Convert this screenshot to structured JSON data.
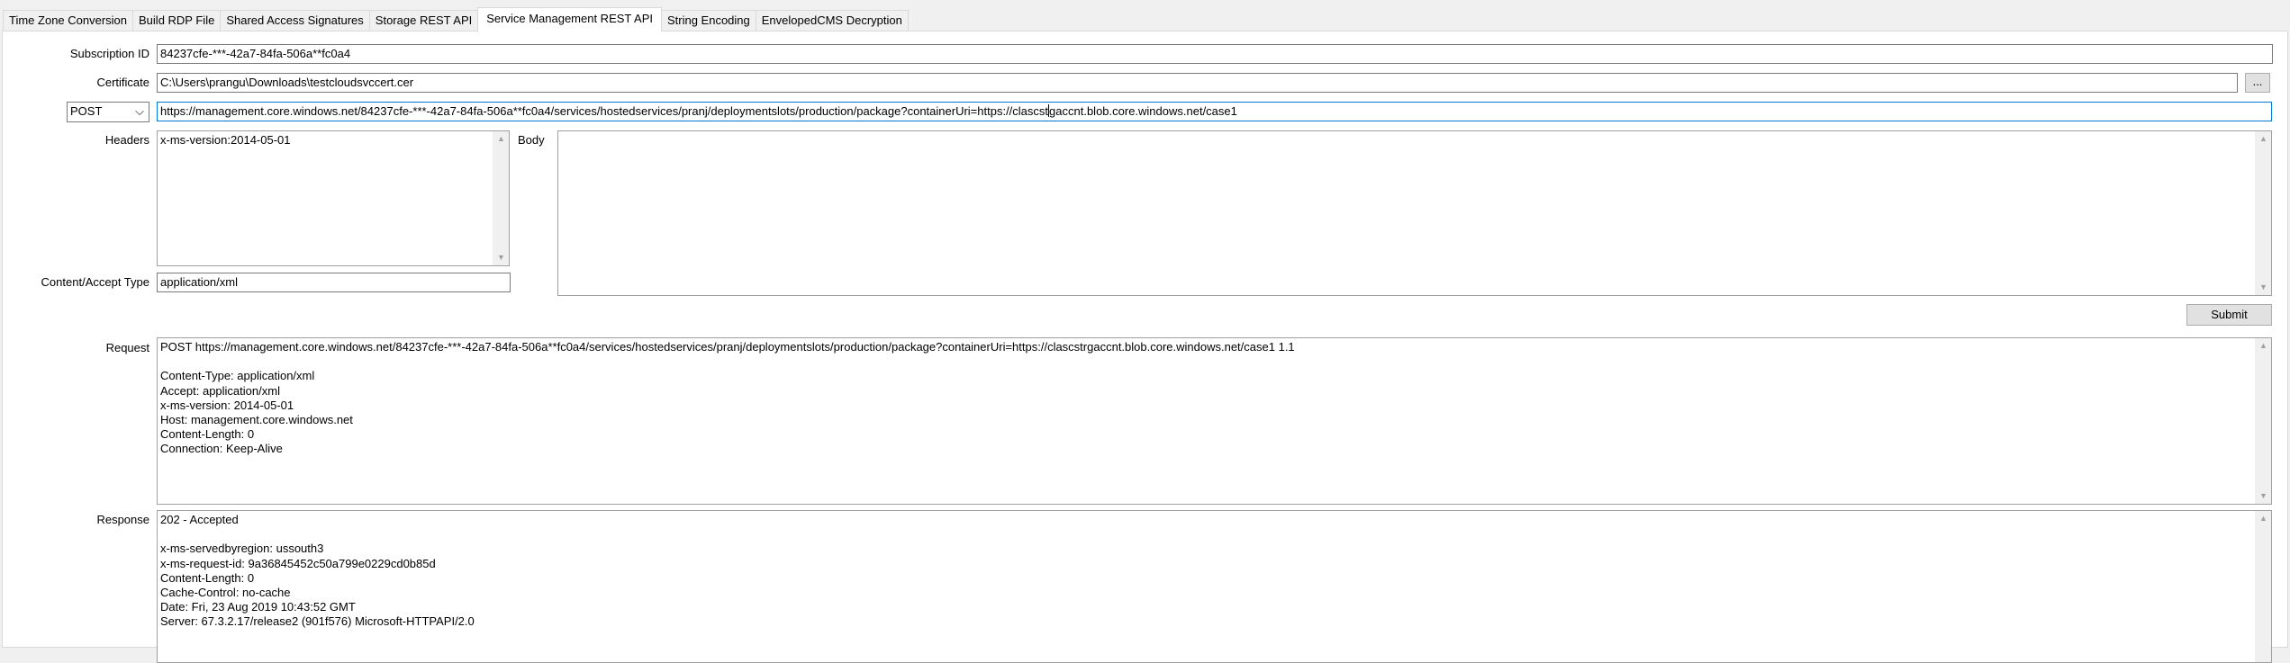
{
  "tabs": [
    {
      "label": "Time Zone Conversion",
      "active": false
    },
    {
      "label": "Build RDP File",
      "active": false
    },
    {
      "label": "Shared Access Signatures",
      "active": false
    },
    {
      "label": "Storage REST API",
      "active": false
    },
    {
      "label": "Service Management REST API",
      "active": true
    },
    {
      "label": "String Encoding",
      "active": false
    },
    {
      "label": "EnvelopedCMS Decryption",
      "active": false
    }
  ],
  "form": {
    "subscription_label": "Subscription ID",
    "subscription_value": "84237cfe-***-42a7-84fa-506a**fc0a4",
    "certificate_label": "Certificate",
    "certificate_value": "C:\\Users\\prangu\\Downloads\\testcloudsvccert.cer",
    "browse_label": "...",
    "method_value": "POST",
    "url_value_before_caret": "https://management.core.windows.net/84237cfe-***-42a7-84fa-506a**fc0a4/services/hostedservices/pranj/deploymentslots/production/package?containerUri=https://clascst",
    "url_value_after_caret": "gaccnt.blob.core.windows.net/case1",
    "headers_label": "Headers",
    "headers_value": "x-ms-version:2014-05-01",
    "body_label": "Body",
    "body_value": "",
    "content_type_label": "Content/Accept Type",
    "content_type_value": "application/xml",
    "submit_label": "Submit",
    "request_label": "Request",
    "request_value": "POST https://management.core.windows.net/84237cfe-***-42a7-84fa-506a**fc0a4/services/hostedservices/pranj/deploymentslots/production/package?containerUri=https://clascstrgaccnt.blob.core.windows.net/case1 1.1\n\nContent-Type: application/xml\nAccept: application/xml\nx-ms-version: 2014-05-01\nHost: management.core.windows.net\nContent-Length: 0\nConnection: Keep-Alive",
    "response_label": "Response",
    "response_value": "202 - Accepted\n\nx-ms-servedbyregion: ussouth3\nx-ms-request-id: 9a36845452c50a799e0229cd0b85d\nContent-Length: 0\nCache-Control: no-cache\nDate: Fri, 23 Aug 2019 10:43:52 GMT\nServer: 67.3.2.17/release2 (901f576) Microsoft-HTTPAPI/2.0"
  },
  "icons": {
    "scroll_up": "▲",
    "scroll_down": "▼",
    "dropdown": "⌵"
  }
}
